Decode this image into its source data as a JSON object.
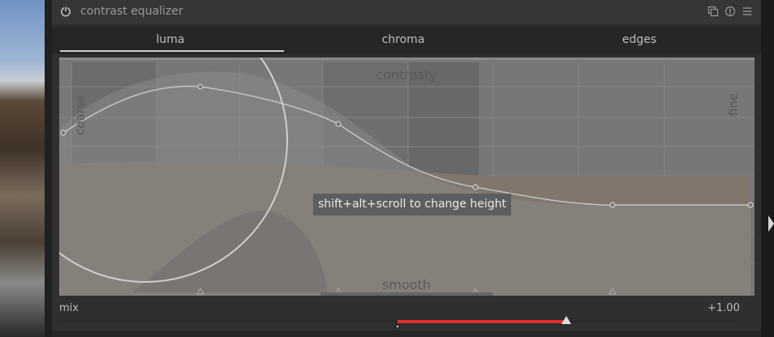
{
  "module": {
    "title": "contrast equalizer",
    "icons": [
      "power-icon",
      "copy-instance-icon",
      "reset-icon",
      "presets-menu-icon"
    ]
  },
  "tabs": [
    {
      "label": "luma",
      "active": true
    },
    {
      "label": "chroma",
      "active": false
    },
    {
      "label": "edges",
      "active": false
    }
  ],
  "graph": {
    "top_label": "contrasty",
    "bottom_label": "smooth",
    "left_label": "coarse",
    "right_label": "fine",
    "tooltip": "shift+alt+scroll to change height"
  },
  "mix": {
    "label": "mix",
    "value_text": "+1.00",
    "value": 1.0,
    "fill_color": "#e5302d"
  },
  "colors": {
    "panel_bg": "#2f2f2f",
    "graph_bg": "#777777",
    "accent_red": "#e5302d"
  }
}
